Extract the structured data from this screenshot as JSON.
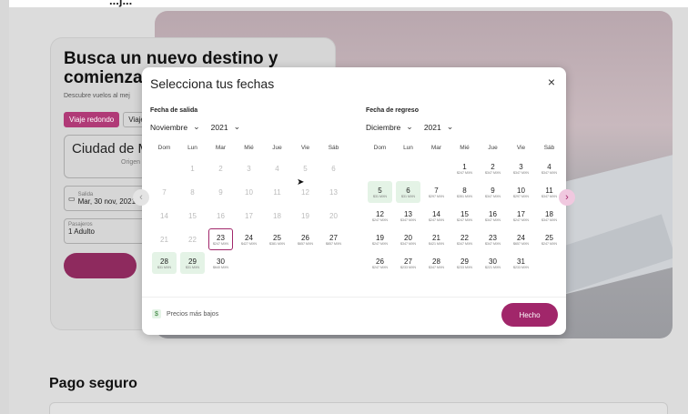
{
  "background": {
    "header_text": "...j...",
    "search_card": {
      "title": "Busca un nuevo destino y comienza",
      "subtitle": "Descubre vuelos al mej",
      "tabs": [
        {
          "label": "Viaje redondo",
          "active": true
        },
        {
          "label": "Viaje",
          "active": false
        }
      ],
      "origin_value": "Ciudad de M",
      "origin_label": "Origen",
      "date_label": "Salida",
      "date_value": "Mar, 30 nov, 2021",
      "pax_label": "Pasajeros",
      "pax_value": "1 Adulto"
    },
    "secure_title": "Pago seguro"
  },
  "modal": {
    "title": "Selecciona tus fechas",
    "close": "×",
    "weekdays": [
      "Dom",
      "Lun",
      "Mar",
      "Mié",
      "Jue",
      "Vie",
      "Sáb"
    ],
    "departure": {
      "label": "Fecha de salida",
      "month": "Noviembre",
      "year": "2021",
      "days": [
        {
          "d": "",
          "p": "",
          "s": "empty"
        },
        {
          "d": "1",
          "p": "",
          "s": "dis"
        },
        {
          "d": "2",
          "p": "",
          "s": "dis"
        },
        {
          "d": "3",
          "p": "",
          "s": "dis"
        },
        {
          "d": "4",
          "p": "",
          "s": "dis"
        },
        {
          "d": "5",
          "p": "",
          "s": "dis"
        },
        {
          "d": "6",
          "p": "",
          "s": "dis"
        },
        {
          "d": "7",
          "p": "",
          "s": "dis"
        },
        {
          "d": "8",
          "p": "",
          "s": "dis"
        },
        {
          "d": "9",
          "p": "",
          "s": "dis"
        },
        {
          "d": "10",
          "p": "",
          "s": "dis"
        },
        {
          "d": "11",
          "p": "",
          "s": "dis"
        },
        {
          "d": "12",
          "p": "",
          "s": "dis"
        },
        {
          "d": "13",
          "p": "",
          "s": "dis"
        },
        {
          "d": "14",
          "p": "",
          "s": "dis"
        },
        {
          "d": "15",
          "p": "",
          "s": "dis"
        },
        {
          "d": "16",
          "p": "",
          "s": "dis"
        },
        {
          "d": "17",
          "p": "",
          "s": "dis"
        },
        {
          "d": "18",
          "p": "",
          "s": "dis"
        },
        {
          "d": "19",
          "p": "",
          "s": "dis"
        },
        {
          "d": "20",
          "p": "",
          "s": "dis"
        },
        {
          "d": "21",
          "p": "",
          "s": "dis"
        },
        {
          "d": "22",
          "p": "",
          "s": "dis"
        },
        {
          "d": "23",
          "p": "$247 MXN",
          "s": "sel-day"
        },
        {
          "d": "24",
          "p": "$427 MXN",
          "s": ""
        },
        {
          "d": "25",
          "p": "$381 MXN",
          "s": ""
        },
        {
          "d": "26",
          "p": "$657 MXN",
          "s": ""
        },
        {
          "d": "27",
          "p": "$857 MXN",
          "s": ""
        },
        {
          "d": "28",
          "p": "$31 MXN",
          "s": "cheap"
        },
        {
          "d": "29",
          "p": "$31 MXN",
          "s": "cheap"
        },
        {
          "d": "30",
          "p": "$640 MXN",
          "s": ""
        }
      ]
    },
    "return": {
      "label": "Fecha de regreso",
      "month": "Diciembre",
      "year": "2021",
      "days": [
        {
          "d": "",
          "p": "",
          "s": "empty"
        },
        {
          "d": "",
          "p": "",
          "s": "empty"
        },
        {
          "d": "",
          "p": "",
          "s": "empty"
        },
        {
          "d": "1",
          "p": "$247 MXN",
          "s": ""
        },
        {
          "d": "2",
          "p": "$347 MXN",
          "s": ""
        },
        {
          "d": "3",
          "p": "$347 MXN",
          "s": ""
        },
        {
          "d": "4",
          "p": "$347 MXN",
          "s": ""
        },
        {
          "d": "5",
          "p": "$31 MXN",
          "s": "cheap"
        },
        {
          "d": "6",
          "p": "$31 MXN",
          "s": "cheap"
        },
        {
          "d": "7",
          "p": "$297 MXN",
          "s": ""
        },
        {
          "d": "8",
          "p": "$351 MXN",
          "s": ""
        },
        {
          "d": "9",
          "p": "$347 MXN",
          "s": ""
        },
        {
          "d": "10",
          "p": "$297 MXN",
          "s": ""
        },
        {
          "d": "11",
          "p": "$347 MXN",
          "s": ""
        },
        {
          "d": "12",
          "p": "$247 MXN",
          "s": ""
        },
        {
          "d": "13",
          "p": "$347 MXN",
          "s": ""
        },
        {
          "d": "14",
          "p": "$247 MXN",
          "s": ""
        },
        {
          "d": "15",
          "p": "$247 MXN",
          "s": ""
        },
        {
          "d": "16",
          "p": "$347 MXN",
          "s": ""
        },
        {
          "d": "17",
          "p": "$247 MXN",
          "s": ""
        },
        {
          "d": "18",
          "p": "$347 MXN",
          "s": ""
        },
        {
          "d": "19",
          "p": "$247 MXN",
          "s": ""
        },
        {
          "d": "20",
          "p": "$347 MXN",
          "s": ""
        },
        {
          "d": "21",
          "p": "$421 MXN",
          "s": ""
        },
        {
          "d": "22",
          "p": "$347 MXN",
          "s": ""
        },
        {
          "d": "23",
          "p": "$347 MXN",
          "s": ""
        },
        {
          "d": "24",
          "p": "$657 MXN",
          "s": ""
        },
        {
          "d": "25",
          "p": "$247 MXN",
          "s": ""
        },
        {
          "d": "26",
          "p": "$247 MXN",
          "s": ""
        },
        {
          "d": "27",
          "p": "$233 MXN",
          "s": ""
        },
        {
          "d": "28",
          "p": "$347 MXN",
          "s": ""
        },
        {
          "d": "29",
          "p": "$233 MXN",
          "s": ""
        },
        {
          "d": "30",
          "p": "$221 MXN",
          "s": ""
        },
        {
          "d": "31",
          "p": "$233 MXN",
          "s": ""
        }
      ]
    },
    "legend": "Precios más bajos",
    "legend_icon": "$",
    "done_label": "Hecho",
    "prev_icon": "‹",
    "next_icon": "›",
    "chevron": "⌄"
  },
  "colors": {
    "accent": "#a1266a",
    "cheap": "#e4f3e6"
  }
}
